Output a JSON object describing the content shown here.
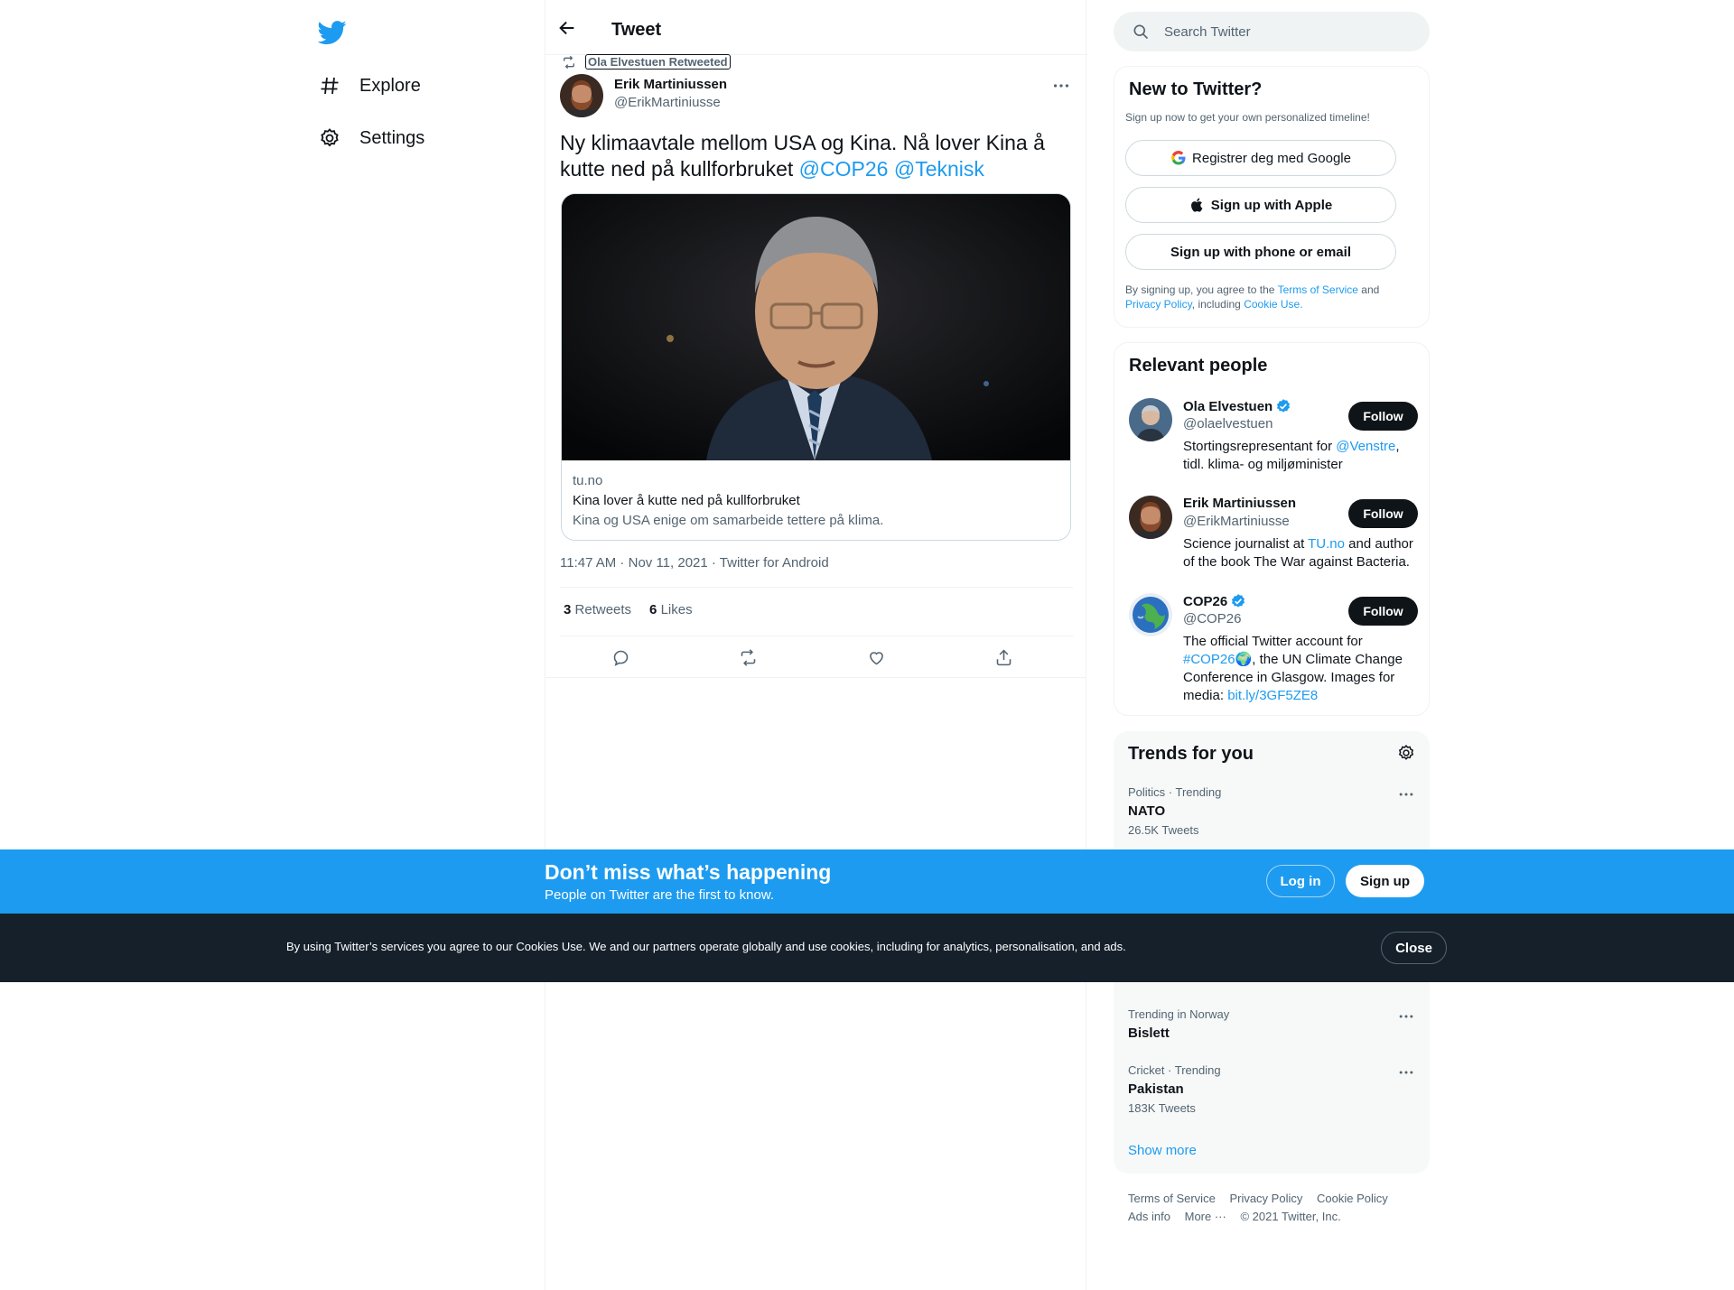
{
  "nav": {
    "items": [
      {
        "label": "Explore",
        "icon": "hashtag-icon"
      },
      {
        "label": "Settings",
        "icon": "gear-icon"
      }
    ]
  },
  "header": {
    "title": "Tweet"
  },
  "tweet": {
    "retweeted_by": "Ola Elvestuen Retweeted",
    "author_name": "Erik Martiniussen",
    "author_handle": "@ErikMartiniusse",
    "text_main": "Ny klimaavtale mellom USA og Kina. Nå lover Kina å kutte ned på kullforbruket",
    "mention_1": "@COP26",
    "mention_2": "@Teknisk",
    "card": {
      "domain": "tu.no",
      "title": "Kina lover å kutte ned på kullforbruket",
      "description": "Kina og USA enige om samarbeide tettere på klima."
    },
    "time": "11:47 AM",
    "date": "Nov 11, 2021",
    "source": "Twitter for Android",
    "retweets_count": "3",
    "retweets_label": "Retweets",
    "likes_count": "6",
    "likes_label": "Likes"
  },
  "search": {
    "placeholder": "Search Twitter"
  },
  "signup": {
    "title": "New to Twitter?",
    "subtitle": "Sign up now to get your own personalized timeline!",
    "google": "Registrer deg med Google",
    "apple": "Sign up with Apple",
    "phone": "Sign up with phone or email",
    "legal_1": "By signing up, you agree to the",
    "terms": "Terms of Service",
    "legal_and": "and",
    "privacy": "Privacy Policy",
    "legal_2": ", including",
    "cookie": "Cookie Use."
  },
  "people": {
    "title": "Relevant people",
    "follow_label": "Follow",
    "list": [
      {
        "name": "Ola Elvestuen",
        "handle": "@olaelvestuen",
        "bio_1": "Stortingsrepresentant for ",
        "bio_link": "@Venstre",
        "bio_2": ", tidl. klima- og miljøminister"
      },
      {
        "name": "Erik Martiniussen",
        "handle": "@ErikMartiniusse",
        "bio_1": "Science journalist at ",
        "bio_link": "TU.no",
        "bio_2": " and author of the book The War against Bacteria."
      },
      {
        "name": "COP26",
        "handle": "@COP26",
        "bio_1": "The official Twitter account for ",
        "bio_link": "#COP26",
        "bio_2": ", the UN Climate Change Conference in Glasgow. Images for media: ",
        "bio_link_2": "bit.ly/3GF5ZE8"
      }
    ]
  },
  "trends": {
    "title": "Trends for you",
    "items": [
      {
        "context": "Politics · Trending",
        "name": "NATO",
        "count": "26.5K Tweets"
      },
      {
        "context": "Trending in Norway",
        "name": "Bislett",
        "count": ""
      },
      {
        "context": "Cricket · Trending",
        "name": "Pakistan",
        "count": "183K Tweets"
      }
    ],
    "show_more": "Show more"
  },
  "footer": {
    "links": [
      "Terms of Service",
      "Privacy Policy",
      "Cookie Policy",
      "Ads info",
      "More ···",
      "© 2021 Twitter, Inc."
    ]
  },
  "bottom_bar": {
    "title": "Don’t miss what’s happening",
    "subtitle": "People on Twitter are the first to know.",
    "login": "Log in",
    "signup": "Sign up"
  },
  "cookie_bar": {
    "text": "By using Twitter’s services you agree to our Cookies Use. We and our partners operate globally and use cookies, including for analytics, personalisation, and ads.",
    "close": "Close"
  },
  "colors": {
    "accent": "#1d9bf0",
    "text": "#0f1419",
    "secondary": "#536471",
    "cookie_bg": "#15202b"
  }
}
